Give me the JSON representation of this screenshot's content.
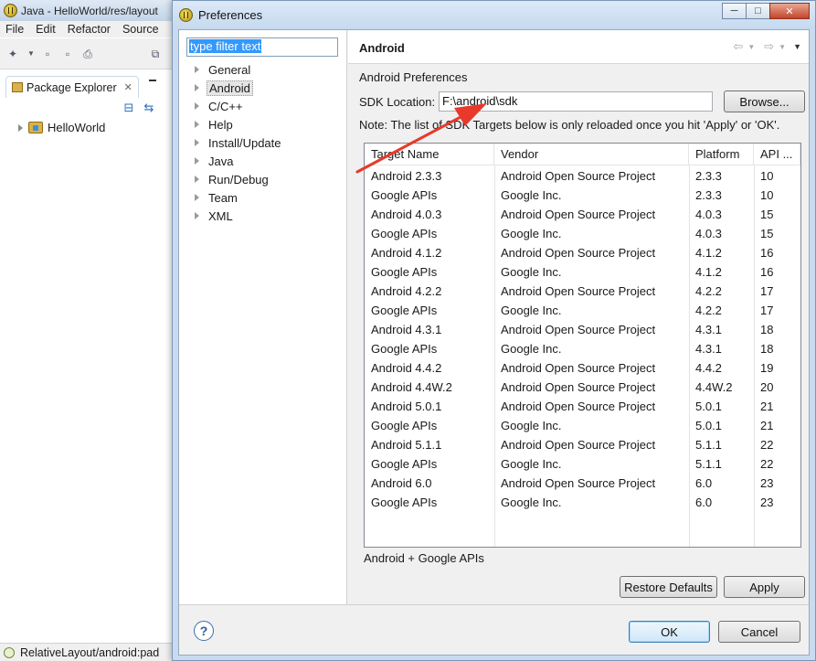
{
  "background_window": {
    "title": "Java - HelloWorld/res/layout",
    "menus": [
      "File",
      "Edit",
      "Refactor",
      "Source"
    ],
    "package_explorer": {
      "tab_label": "Package Explorer",
      "tree": [
        "HelloWorld"
      ]
    },
    "status_bar": "RelativeLayout/android:pad"
  },
  "dialog": {
    "title": "Preferences",
    "window_buttons": {
      "minimize": "─",
      "maximize": "□",
      "close": "✕"
    },
    "filter": {
      "value": "type filter text"
    },
    "tree": [
      {
        "label": "General"
      },
      {
        "label": "Android",
        "selected": true
      },
      {
        "label": "C/C++"
      },
      {
        "label": "Help"
      },
      {
        "label": "Install/Update"
      },
      {
        "label": "Java"
      },
      {
        "label": "Run/Debug"
      },
      {
        "label": "Team"
      },
      {
        "label": "XML"
      }
    ],
    "page": {
      "title": "Android",
      "section_label": "Android Preferences",
      "sdk_label": "SDK Location:",
      "sdk_value": "F:\\android\\sdk",
      "browse_label": "Browse...",
      "note": "Note: The list of SDK Targets below is only reloaded once you hit 'Apply' or 'OK'.",
      "table": {
        "columns": [
          "Target Name",
          "Vendor",
          "Platform",
          "API ..."
        ],
        "rows": [
          [
            "Android 2.3.3",
            "Android Open Source Project",
            "2.3.3",
            "10"
          ],
          [
            "Google APIs",
            "Google Inc.",
            "2.3.3",
            "10"
          ],
          [
            "Android 4.0.3",
            "Android Open Source Project",
            "4.0.3",
            "15"
          ],
          [
            "Google APIs",
            "Google Inc.",
            "4.0.3",
            "15"
          ],
          [
            "Android 4.1.2",
            "Android Open Source Project",
            "4.1.2",
            "16"
          ],
          [
            "Google APIs",
            "Google Inc.",
            "4.1.2",
            "16"
          ],
          [
            "Android 4.2.2",
            "Android Open Source Project",
            "4.2.2",
            "17"
          ],
          [
            "Google APIs",
            "Google Inc.",
            "4.2.2",
            "17"
          ],
          [
            "Android 4.3.1",
            "Android Open Source Project",
            "4.3.1",
            "18"
          ],
          [
            "Google APIs",
            "Google Inc.",
            "4.3.1",
            "18"
          ],
          [
            "Android 4.4.2",
            "Android Open Source Project",
            "4.4.2",
            "19"
          ],
          [
            "Android 4.4W.2",
            "Android Open Source Project",
            "4.4W.2",
            "20"
          ],
          [
            "Android 5.0.1",
            "Android Open Source Project",
            "5.0.1",
            "21"
          ],
          [
            "Google APIs",
            "Google Inc.",
            "5.0.1",
            "21"
          ],
          [
            "Android 5.1.1",
            "Android Open Source Project",
            "5.1.1",
            "22"
          ],
          [
            "Google APIs",
            "Google Inc.",
            "5.1.1",
            "22"
          ],
          [
            "Android 6.0",
            "Android Open Source Project",
            "6.0",
            "23"
          ],
          [
            "Google APIs",
            "Google Inc.",
            "6.0",
            "23"
          ]
        ]
      },
      "selected_target": "Android + Google APIs",
      "restore_defaults_label": "Restore Defaults",
      "apply_label": "Apply"
    },
    "footer": {
      "help_label": "?",
      "ok_label": "OK",
      "cancel_label": "Cancel"
    }
  },
  "colors": {
    "dialog_frame": "#c9dbf0",
    "selection": "#3399ff",
    "annotation_arrow": "#e8392b"
  }
}
